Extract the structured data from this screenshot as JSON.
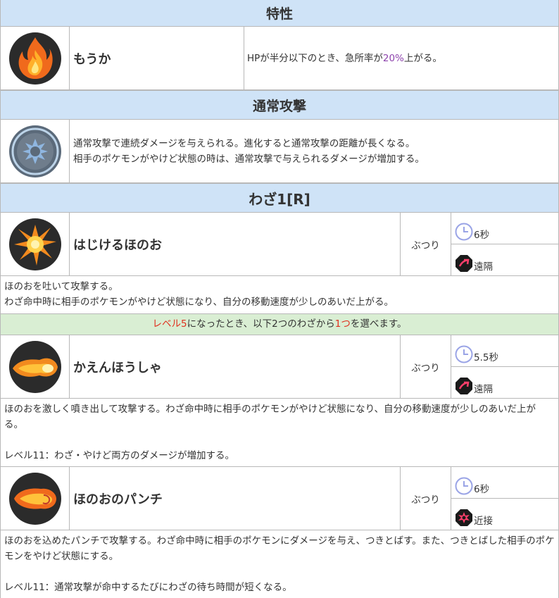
{
  "ability": {
    "header": "特性",
    "name": "もうか",
    "desc_pre": "HPが半分以下のとき、急所率が",
    "desc_value": "20%",
    "desc_post": "上がる。",
    "icon": "flame-icon"
  },
  "basic": {
    "header": "通常攻撃",
    "line1": "通常攻撃で連続ダメージを与えられる。進化すると通常攻撃の距離が長くなる。",
    "line2": "相手のポケモンがやけど状態の時は、通常攻撃で与えられるダメージが増加する。",
    "icon": "basic-attack-icon"
  },
  "move1": {
    "header": "わざ1[R]",
    "name": "はじけるほのお",
    "tag": "ぶつり",
    "cooldown": "6秒",
    "range": "遠隔",
    "line1": "ほのおを吐いて攻撃する。",
    "line2": "わざ命中時に相手のポケモンがやけど状態になり、自分の移動速度が少しのあいだ上がる。",
    "icon": "ember-icon"
  },
  "upgrade_note": {
    "part1": "レベル5",
    "part2": "になったとき、以下2つのわざから",
    "part3": "1つ",
    "part4": "を選べます。"
  },
  "move2": {
    "name": "かえんほうしゃ",
    "tag": "ぶつり",
    "cooldown": "5.5秒",
    "range": "遠隔",
    "desc": "ほのおを激しく噴き出して攻撃する。わざ命中時に相手のポケモンがやけど状態になり、自分の移動速度が少しのあいだ上がる。",
    "upgrade": "レベル11：わざ・やけど両方のダメージが増加する。",
    "icon": "flamethrower-icon"
  },
  "move3": {
    "name": "ほのおのパンチ",
    "tag": "ぶつり",
    "cooldown": "6秒",
    "range": "近接",
    "desc": "ほのおを込めたパンチで攻撃する。わざ命中時に相手のポケモンにダメージを与え、つきとばす。また、つきとばした相手のポケモンをやけど状態にする。",
    "upgrade": "レベル11：通常攻撃が命中するたびにわざの待ち時間が短くなる。",
    "icon": "fire-punch-icon"
  },
  "colors": {
    "header_bg": "#cfe3f7",
    "note_bg": "#d9eed3",
    "highlight_red": "#e0301e",
    "highlight_purple": "#8e44ad"
  }
}
